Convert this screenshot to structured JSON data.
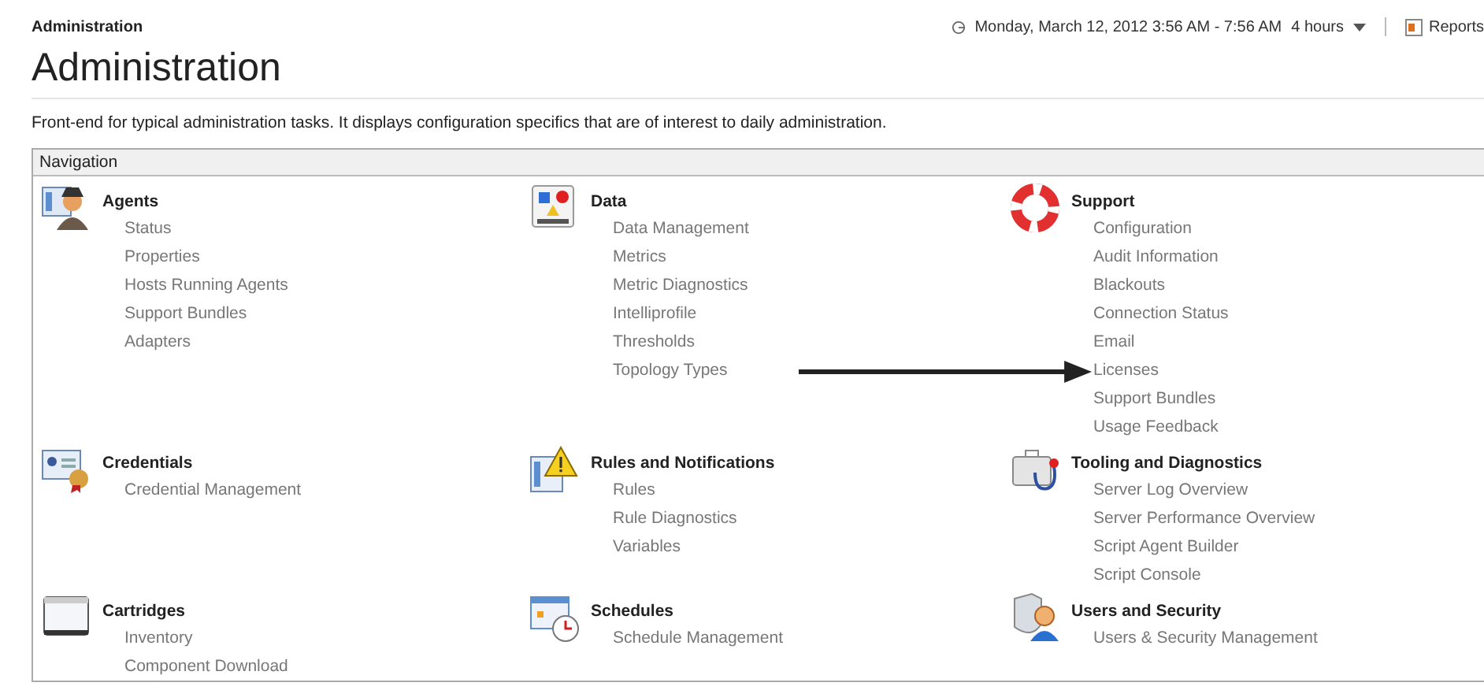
{
  "breadcrumb": "Administration",
  "time_range": {
    "text": "Monday, March 12, 2012 3:56 AM - 7:56 AM",
    "duration": "4 hours"
  },
  "reports": "Reports",
  "title": "Administration",
  "description": "Front-end for typical administration tasks. It displays configuration specifics that are of interest to daily administration.",
  "navigation": {
    "title": "Navigation",
    "sections": [
      {
        "title": "Agents",
        "links": [
          "Status",
          "Properties",
          "Hosts Running Agents",
          "Support Bundles",
          "Adapters"
        ]
      },
      {
        "title": "Data",
        "links": [
          "Data Management",
          "Metrics",
          "Metric Diagnostics",
          "Intelliprofile",
          "Thresholds",
          "Topology Types"
        ]
      },
      {
        "title": "Support",
        "links": [
          "Configuration",
          "Audit Information",
          "Blackouts",
          "Connection Status",
          "Email",
          "Licenses",
          "Support Bundles",
          "Usage Feedback"
        ]
      },
      {
        "title": "Credentials",
        "links": [
          "Credential Management"
        ]
      },
      {
        "title": "Rules and Notifications",
        "links": [
          "Rules",
          "Rule Diagnostics",
          "Variables"
        ]
      },
      {
        "title": "Tooling and Diagnostics",
        "links": [
          "Server Log Overview",
          "Server Performance Overview",
          "Script Agent Builder",
          "Script Console"
        ]
      },
      {
        "title": "Cartridges",
        "links": [
          "Inventory",
          "Component Download"
        ]
      },
      {
        "title": "Schedules",
        "links": [
          "Schedule Management"
        ]
      },
      {
        "title": "Users and Security",
        "links": [
          "Users & Security Management"
        ]
      }
    ]
  }
}
